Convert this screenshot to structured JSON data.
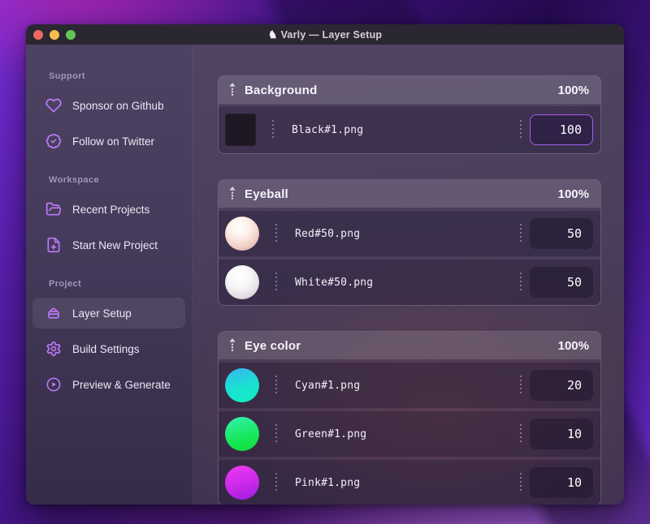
{
  "titlebar": {
    "title": "Varly — Layer Setup",
    "app_icon_glyph": "♞",
    "traffic_lights": {
      "close": "#ed6a5f",
      "minimize": "#f5bd4f",
      "zoom": "#62c554"
    }
  },
  "sidebar": {
    "sections": [
      {
        "label": "Support",
        "items": [
          {
            "icon": "heart-icon",
            "label": "Sponsor on Github"
          },
          {
            "icon": "badge-check-icon",
            "label": "Follow on Twitter"
          }
        ]
      },
      {
        "label": "Workspace",
        "items": [
          {
            "icon": "folder-open-icon",
            "label": "Recent Projects"
          },
          {
            "icon": "file-plus-icon",
            "label": "Start New Project"
          }
        ]
      },
      {
        "label": "Project",
        "items": [
          {
            "icon": "layer-box-icon",
            "label": "Layer Setup",
            "active": true
          },
          {
            "icon": "gear-icon",
            "label": "Build Settings"
          },
          {
            "icon": "play-circle-icon",
            "label": "Preview & Generate"
          }
        ]
      }
    ]
  },
  "layers": {
    "groups": [
      {
        "name": "Background",
        "weight": "100%",
        "items": [
          {
            "file": "Black#1.png",
            "value": "100",
            "thumb": "black-square",
            "focused": true
          }
        ]
      },
      {
        "name": "Eyeball",
        "weight": "100%",
        "items": [
          {
            "file": "Red#50.png",
            "value": "50",
            "thumb": "sphere-red"
          },
          {
            "file": "White#50.png",
            "value": "50",
            "thumb": "sphere-white"
          }
        ]
      },
      {
        "name": "Eye color",
        "weight": "100%",
        "items": [
          {
            "file": "Cyan#1.png",
            "value": "20",
            "thumb": "circle-cyan"
          },
          {
            "file": "Green#1.png",
            "value": "10",
            "thumb": "circle-green"
          },
          {
            "file": "Pink#1.png",
            "value": "10",
            "thumb": "circle-pink"
          }
        ]
      }
    ]
  },
  "palette": {
    "accent": "#a55df2",
    "sidebar_icon": "#bd7bfa",
    "titlebar_bg": "#2b2732",
    "thumb_cyan": [
      "#38b4f2",
      "#10efc4"
    ],
    "thumb_green": [
      "#36f0b4",
      "#0fdd38"
    ],
    "thumb_pink": [
      "#ef3af2",
      "#9b1ce0"
    ]
  }
}
